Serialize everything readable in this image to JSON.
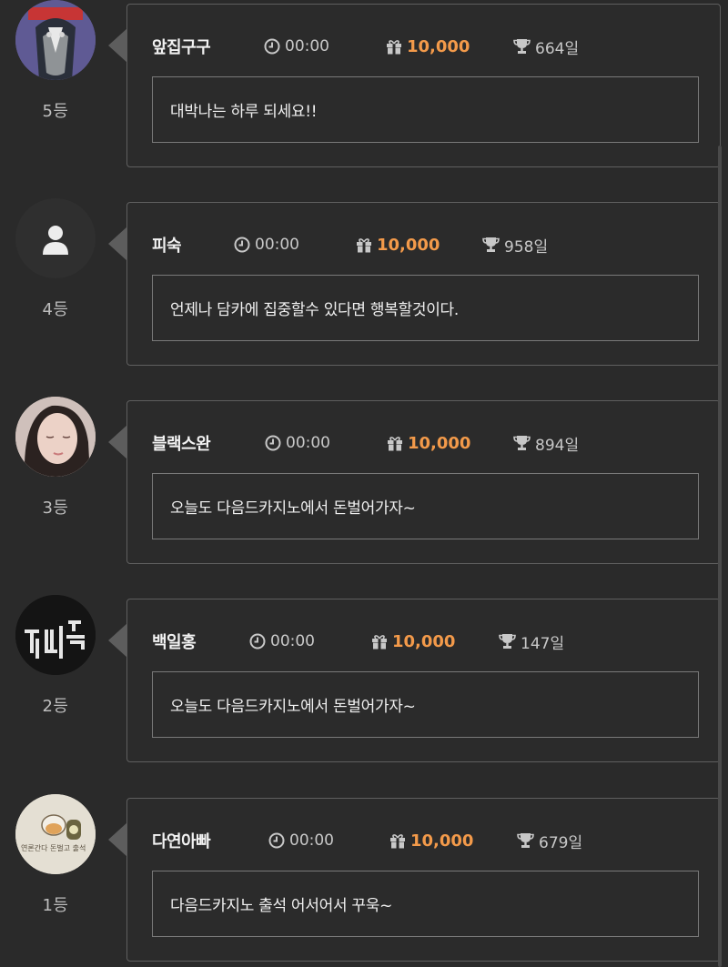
{
  "entries": [
    {
      "rank": "5등",
      "nickname": "앞집구구",
      "time": "00:00",
      "points": "10,000",
      "days": "664일",
      "message": "대박나는 하루 되세요!!",
      "avatar": "cartoon-bird"
    },
    {
      "rank": "4등",
      "nickname": "피숙",
      "time": "00:00",
      "points": "10,000",
      "days": "958일",
      "message": "언제나 담카에 집중할수 있다면 행복할것이다.",
      "avatar": "default-user"
    },
    {
      "rank": "3등",
      "nickname": "블랙스완",
      "time": "00:00",
      "points": "10,000",
      "days": "894일",
      "message": "오늘도 다음드카지노에서 돈벌어가자~",
      "avatar": "portrait"
    },
    {
      "rank": "2등",
      "nickname": "백일홍",
      "time": "00:00",
      "points": "10,000",
      "days": "147일",
      "message": "오늘도 다음드카지노에서 돈벌어가자~",
      "avatar": "neon-sign"
    },
    {
      "rank": "1등",
      "nickname": "다연아빠",
      "time": "00:00",
      "points": "10,000",
      "days": "679일",
      "message": "다음드카지노 출석 어서어서 꾸욱~",
      "avatar": "hamster-drawing"
    }
  ],
  "colors": {
    "background": "#2a2a2a",
    "points": "#f39a4a",
    "card_border": "#5f5f5f",
    "message_border": "#7a7a7a"
  }
}
